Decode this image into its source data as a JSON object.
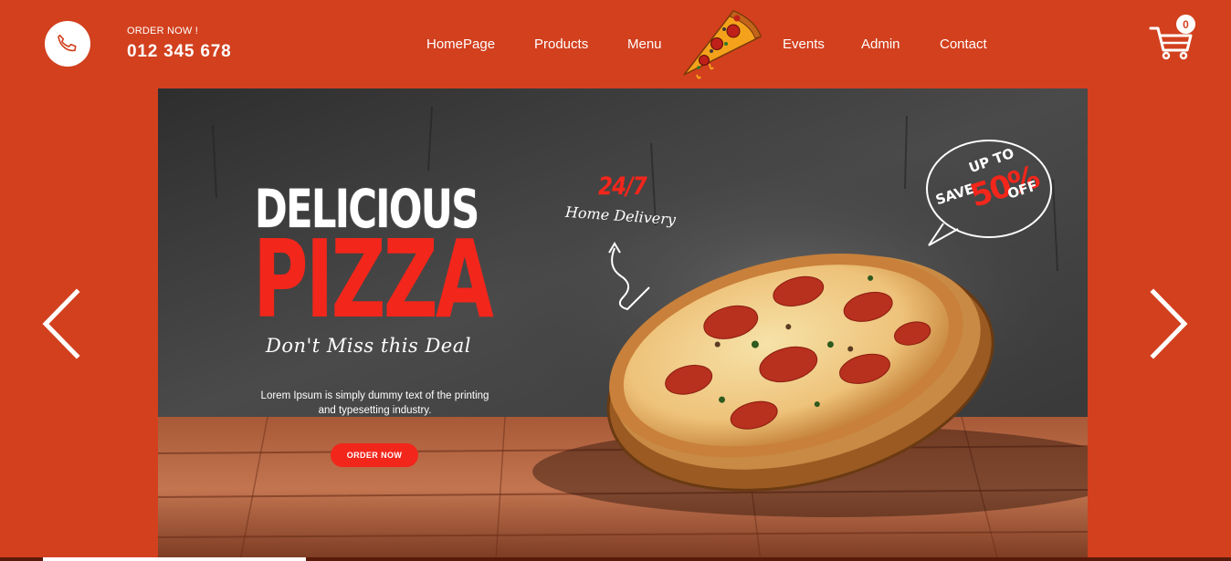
{
  "header": {
    "order_label": "ORDER NOW !",
    "phone": "012 345 678",
    "nav": [
      {
        "label": "HomePage"
      },
      {
        "label": "Products"
      },
      {
        "label": "Menu"
      },
      {
        "label": "Events"
      },
      {
        "label": "Admin"
      },
      {
        "label": "Contact"
      }
    ],
    "cart_count": "0",
    "icons": {
      "phone": "phone-icon",
      "cart": "cart-icon",
      "logo": "pizza-slice-logo"
    }
  },
  "slide": {
    "headline_1": "DELICIOUS",
    "headline_2": "PIZZA",
    "tagline": "Don't Miss this Deal",
    "description": "Lorem Ipsum is simply dummy text of the printing and typesetting industry.",
    "cta": "ORDER NOW",
    "delivery_hours": "24/7",
    "delivery_text": "Home Delivery",
    "promo": {
      "up_to": "UP TO",
      "save": "SAVE",
      "percent": "50%",
      "off": "OFF"
    }
  },
  "colors": {
    "brand": "#d2401e",
    "accent_red": "#f2261b",
    "white": "#ffffff"
  }
}
